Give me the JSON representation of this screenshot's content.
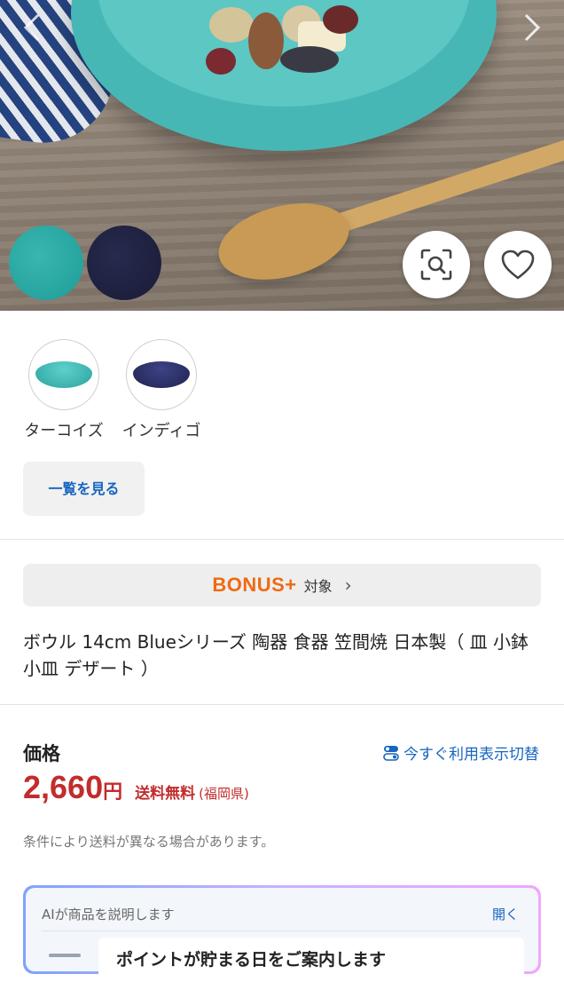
{
  "hero": {
    "prev_icon": "chevron-left-icon",
    "next_icon": "chevron-right-icon",
    "lens_icon": "image-search-icon",
    "favorite_icon": "heart-icon",
    "swatch_colors": [
      "#2aaba6",
      "#1f2040"
    ]
  },
  "variants": {
    "items": [
      {
        "label": "ターコイズ",
        "color": "#3fb8b2"
      },
      {
        "label": "インディゴ",
        "color": "#2b3066"
      }
    ],
    "view_all_label": "一覧を見る"
  },
  "bonus": {
    "logo": "BONUS+",
    "text": "対象",
    "chevron": "›"
  },
  "product": {
    "title": "ボウル 14cm Blueシリーズ 陶器 食器 笠間焼 日本製（ 皿 小鉢 小皿 デザート ）"
  },
  "price": {
    "label": "価格",
    "switch_label": "今すぐ利用表示切替",
    "amount": "2,660",
    "currency": "円",
    "shipping": "送料無料",
    "shipping_area": "(福岡県)",
    "note": "条件により送料が異なる場合があります。"
  },
  "ai": {
    "title": "AIが商品を説明します",
    "open_label": "開く",
    "card_text": "ポイントが貯まる日をご案内します"
  },
  "colors": {
    "accent_blue": "#1665c0",
    "price_red": "#c22c2c",
    "bonus_orange": "#ef6a14"
  }
}
